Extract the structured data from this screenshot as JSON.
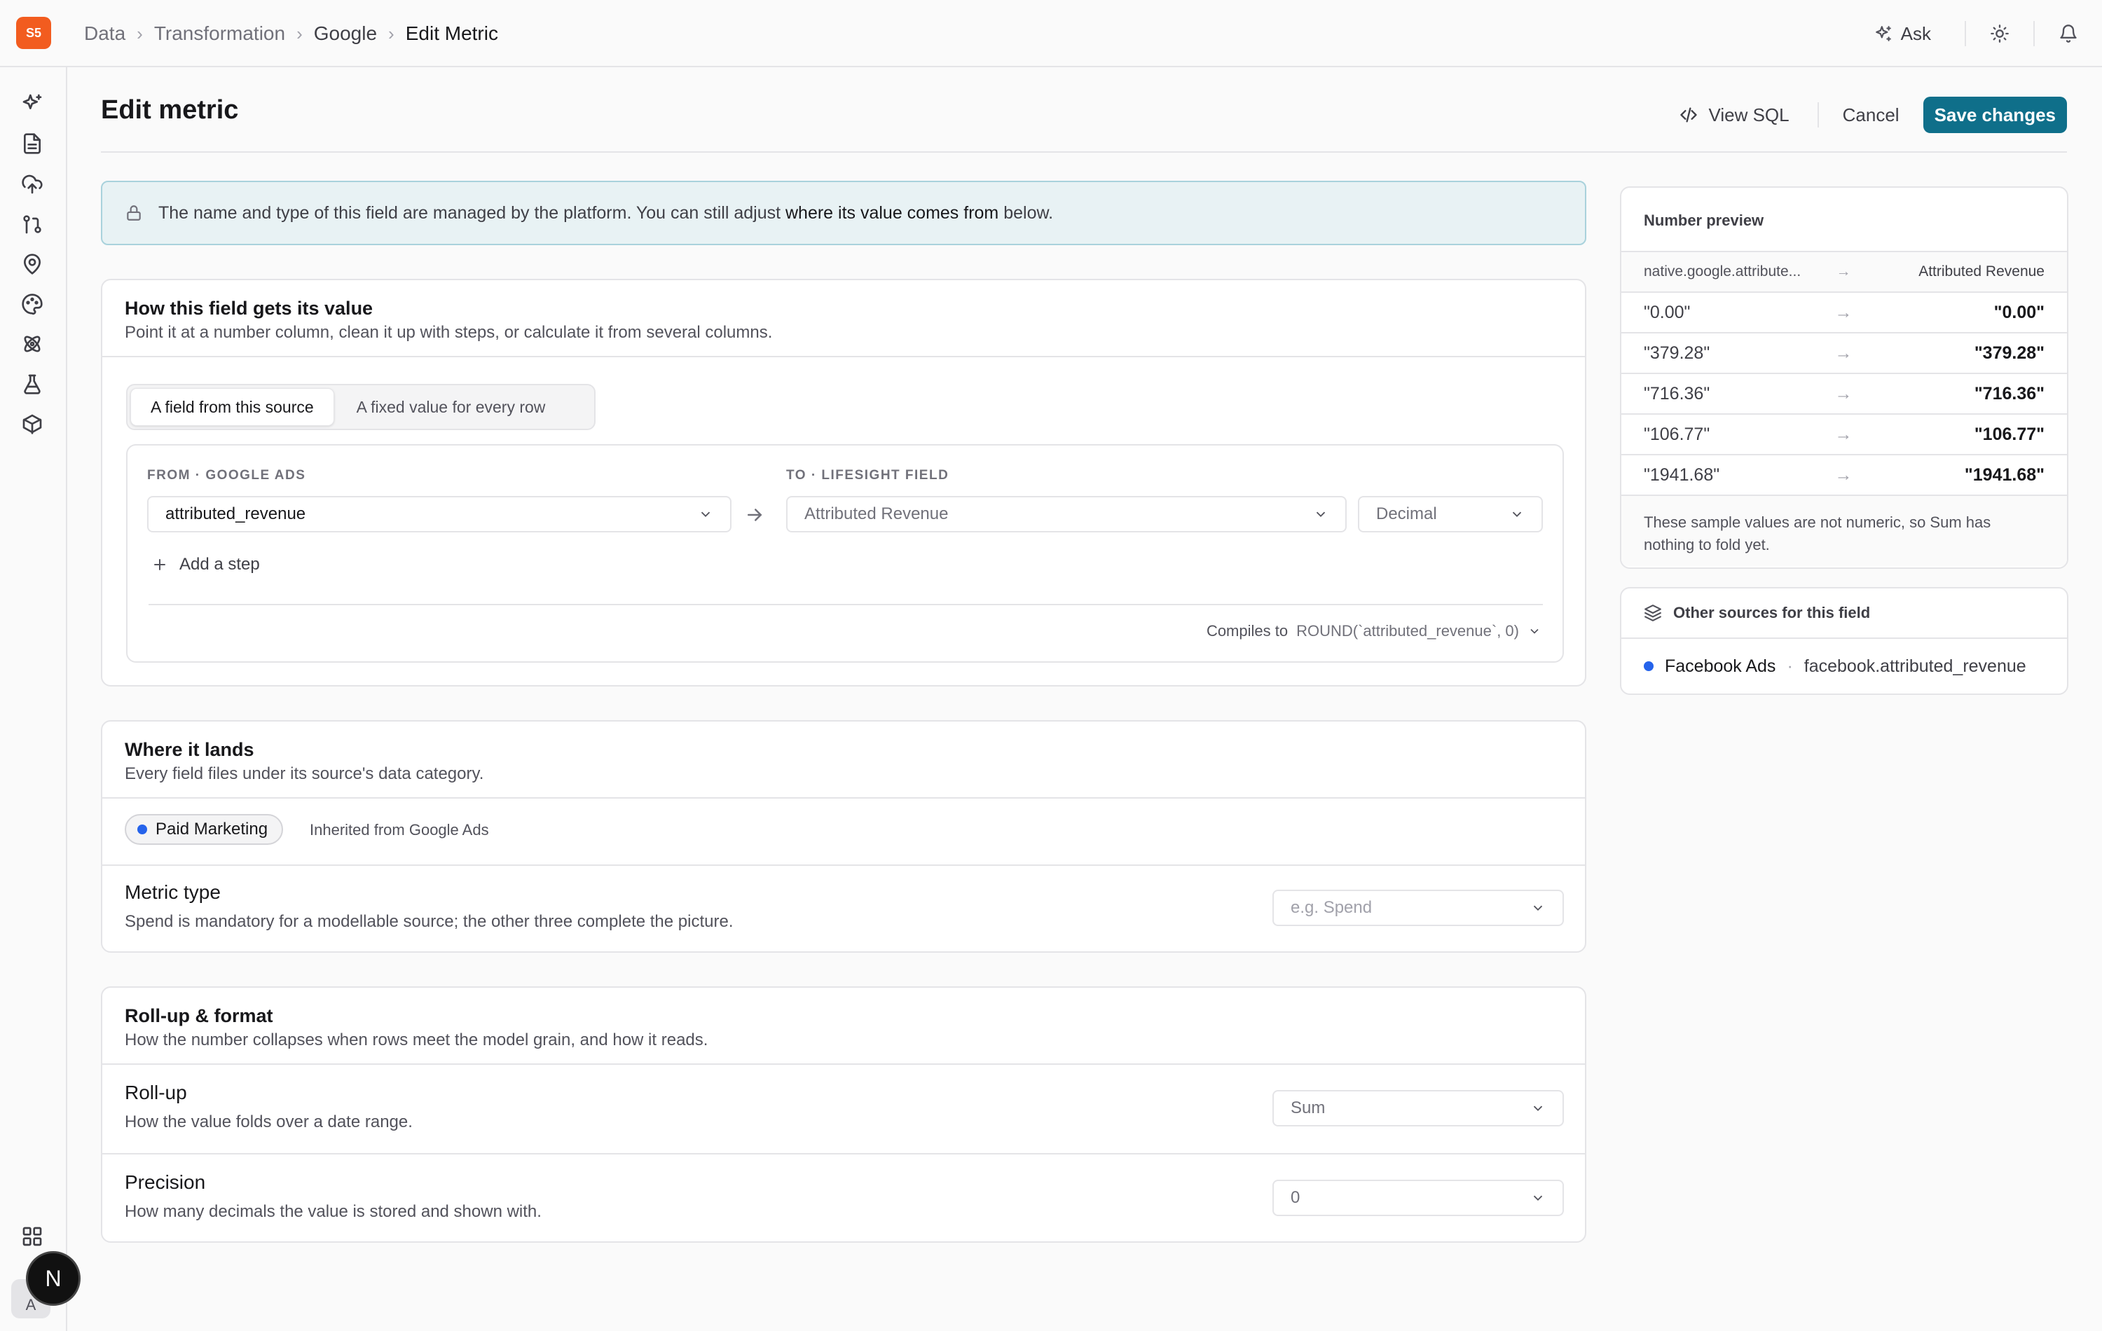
{
  "app": {
    "logo_text": "S5"
  },
  "breadcrumb": [
    "Data",
    "Transformation",
    "Google",
    "Edit Metric"
  ],
  "topbar": {
    "ask_label": "Ask"
  },
  "page": {
    "title": "Edit metric",
    "view_sql_label": "View SQL",
    "cancel_label": "Cancel",
    "save_label": "Save changes"
  },
  "notice": {
    "text_before": "The name and type of this field are managed by the platform. You can still adjust ",
    "text_strong": "where its value comes from",
    "text_after": " below."
  },
  "value_card": {
    "title": "How this field gets its value",
    "subtitle": "Point it at a number column, clean it up with steps, or calculate it from several columns.",
    "tabs": [
      "A field from this source",
      "A fixed value for every row"
    ],
    "active_tab": 0,
    "from_label": "FROM · GOOGLE ADS",
    "from_value": "attributed_revenue",
    "to_label": "TO · LIFESIGHT FIELD",
    "to_value": "Attributed Revenue",
    "type_value": "Decimal",
    "add_step_label": "Add a step",
    "compiles_label": "Compiles to",
    "compiles_code": "ROUND(`attributed_revenue`, 0)"
  },
  "lands_card": {
    "title": "Where it lands",
    "subtitle": "Every field files under its source's data category.",
    "category": "Paid Marketing",
    "category_color": "#2563eb",
    "inherited": "Inherited from Google Ads",
    "metric_type_title": "Metric type",
    "metric_type_sub": "Spend is mandatory for a modellable source; the other three complete the picture.",
    "metric_type_placeholder": "e.g. Spend"
  },
  "rollup_card": {
    "title": "Roll-up & format",
    "subtitle": "How the number collapses when rows meet the model grain, and how it reads.",
    "rollup_title": "Roll-up",
    "rollup_sub": "How the value folds over a date range.",
    "rollup_value": "Sum",
    "precision_title": "Precision",
    "precision_sub": "How many decimals the value is stored and shown with.",
    "precision_value": "0"
  },
  "preview": {
    "title": "Number preview",
    "col_left": "native.google.attribute...",
    "col_right": "Attributed Revenue",
    "rows": [
      {
        "in": "\"0.00\"",
        "out": "\"0.00\""
      },
      {
        "in": "\"379.28\"",
        "out": "\"379.28\""
      },
      {
        "in": "\"716.36\"",
        "out": "\"716.36\""
      },
      {
        "in": "\"106.77\"",
        "out": "\"106.77\""
      },
      {
        "in": "\"1941.68\"",
        "out": "\"1941.68\""
      }
    ],
    "note": "These sample values are not numeric, so Sum has nothing to fold yet."
  },
  "other_sources": {
    "title": "Other sources for this field",
    "items": [
      {
        "name": "Facebook Ads",
        "field": "facebook.attributed_revenue",
        "color": "#2563eb"
      }
    ]
  },
  "user": {
    "avatar_primary": "N",
    "avatar_secondary": "A"
  },
  "colors": {
    "accent": "#0f6f8a",
    "brand": "#f25c1f"
  }
}
